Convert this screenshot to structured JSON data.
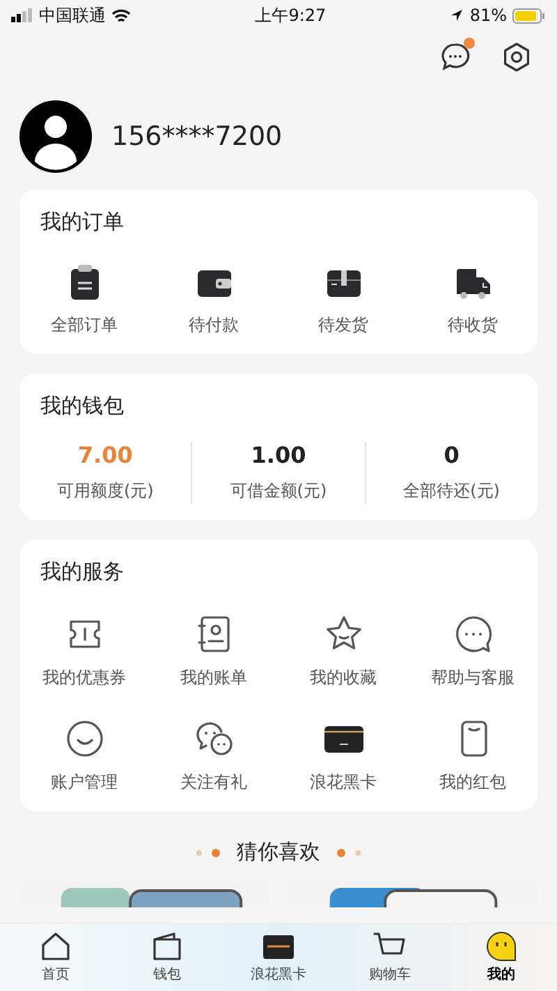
{
  "status_bar": {
    "carrier": "中国联通",
    "time": "上午9:27",
    "battery": "81%"
  },
  "header": {
    "has_unread": true
  },
  "profile": {
    "phone": "156****7200"
  },
  "orders": {
    "title": "我的订单",
    "items": [
      {
        "kind": "clipboard",
        "label": "全部订单"
      },
      {
        "kind": "wallet",
        "label": "待付款"
      },
      {
        "kind": "box",
        "label": "待发货"
      },
      {
        "kind": "truck",
        "label": "待收货"
      }
    ]
  },
  "wallet": {
    "title": "我的钱包",
    "stats": [
      {
        "value": "7.00",
        "label": "可用额度(元)",
        "highlight": true
      },
      {
        "value": "1.00",
        "label": "可借金额(元)",
        "highlight": false
      },
      {
        "value": "0",
        "label": "全部待还(元)",
        "highlight": false
      }
    ]
  },
  "services": {
    "title": "我的服务",
    "items": [
      {
        "kind": "ticket",
        "label": "我的优惠券"
      },
      {
        "kind": "bill",
        "label": "我的账单"
      },
      {
        "kind": "star",
        "label": "我的收藏"
      },
      {
        "kind": "chat",
        "label": "帮助与客服"
      },
      {
        "kind": "smile",
        "label": "账户管理"
      },
      {
        "kind": "wechat",
        "label": "关注有礼"
      },
      {
        "kind": "card",
        "label": "浪花黑卡"
      },
      {
        "kind": "envelope",
        "label": "我的红包"
      }
    ]
  },
  "recommend": {
    "title": "猜你喜欢"
  },
  "tab_bar": [
    {
      "kind": "home",
      "label": "首页",
      "selected": false
    },
    {
      "kind": "wallet",
      "label": "钱包",
      "selected": false
    },
    {
      "kind": "card",
      "label": "浪花黑卡",
      "selected": false
    },
    {
      "kind": "cart",
      "label": "购物车",
      "selected": false
    },
    {
      "kind": "me",
      "label": "我的",
      "selected": true
    }
  ]
}
